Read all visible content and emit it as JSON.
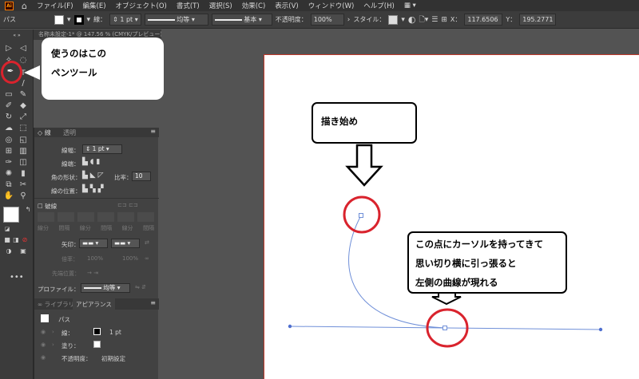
{
  "menu": {
    "items": [
      "ファイル(F)",
      "編集(E)",
      "オブジェクト(O)",
      "書式(T)",
      "選択(S)",
      "効果(C)",
      "表示(V)",
      "ウィンドウ(W)",
      "ヘルプ(H)"
    ]
  },
  "control": {
    "selection": "パス",
    "stroke_label": "線：",
    "stroke_weight": "1 pt",
    "profile": "均等",
    "brush": "基本",
    "opacity_label": "不透明度：",
    "opacity": "100%",
    "style_label": "スタイル：",
    "x_label": "X：",
    "x_value": "117.6506",
    "y_label": "Y：",
    "y_value": "195.2771"
  },
  "document_tab": "名称未設定-1* @ 147.56 % (CMYK/プレビュー)",
  "stroke_panel": {
    "tabs": [
      "線",
      "透明"
    ],
    "weight_label": "線幅：",
    "weight_value": "1 pt",
    "cap_label": "線端：",
    "corner_label": "角の形状：",
    "limit_label": "比率：",
    "limit_value": "10",
    "align_label": "線の位置：",
    "dashed_label": "破線",
    "dash_labels": [
      "線分",
      "間隔",
      "線分",
      "間隔",
      "線分",
      "間隔"
    ],
    "arrow_label": "矢印：",
    "scale_label": "倍率：",
    "scale_values": [
      "100%",
      "100%"
    ],
    "align_arrow_label": "先端位置：",
    "profile_label": "プロファイル：",
    "profile_value": "均等"
  },
  "appearance_panel": {
    "tabs": [
      "ライブラリ",
      "アピアランス"
    ],
    "title": "パス",
    "stroke_label": "線：",
    "stroke_value": "1 pt",
    "fill_label": "塗り：",
    "opacity_label": "不透明度：",
    "opacity_value": "初期設定"
  },
  "annotations": {
    "pen_tool_line1": "使うのはこの",
    "pen_tool_line2": "ペンツール",
    "start": "描き始め",
    "drag_line1": "この点にカーソルを持ってきて",
    "drag_line2": "思い切り横に引っ張ると",
    "drag_line3": "左側の曲線が現れる"
  },
  "colors": {
    "highlight_red": "#d9232d",
    "path_blue": "#6f8fd8",
    "artboard_border": "#c0392b"
  }
}
